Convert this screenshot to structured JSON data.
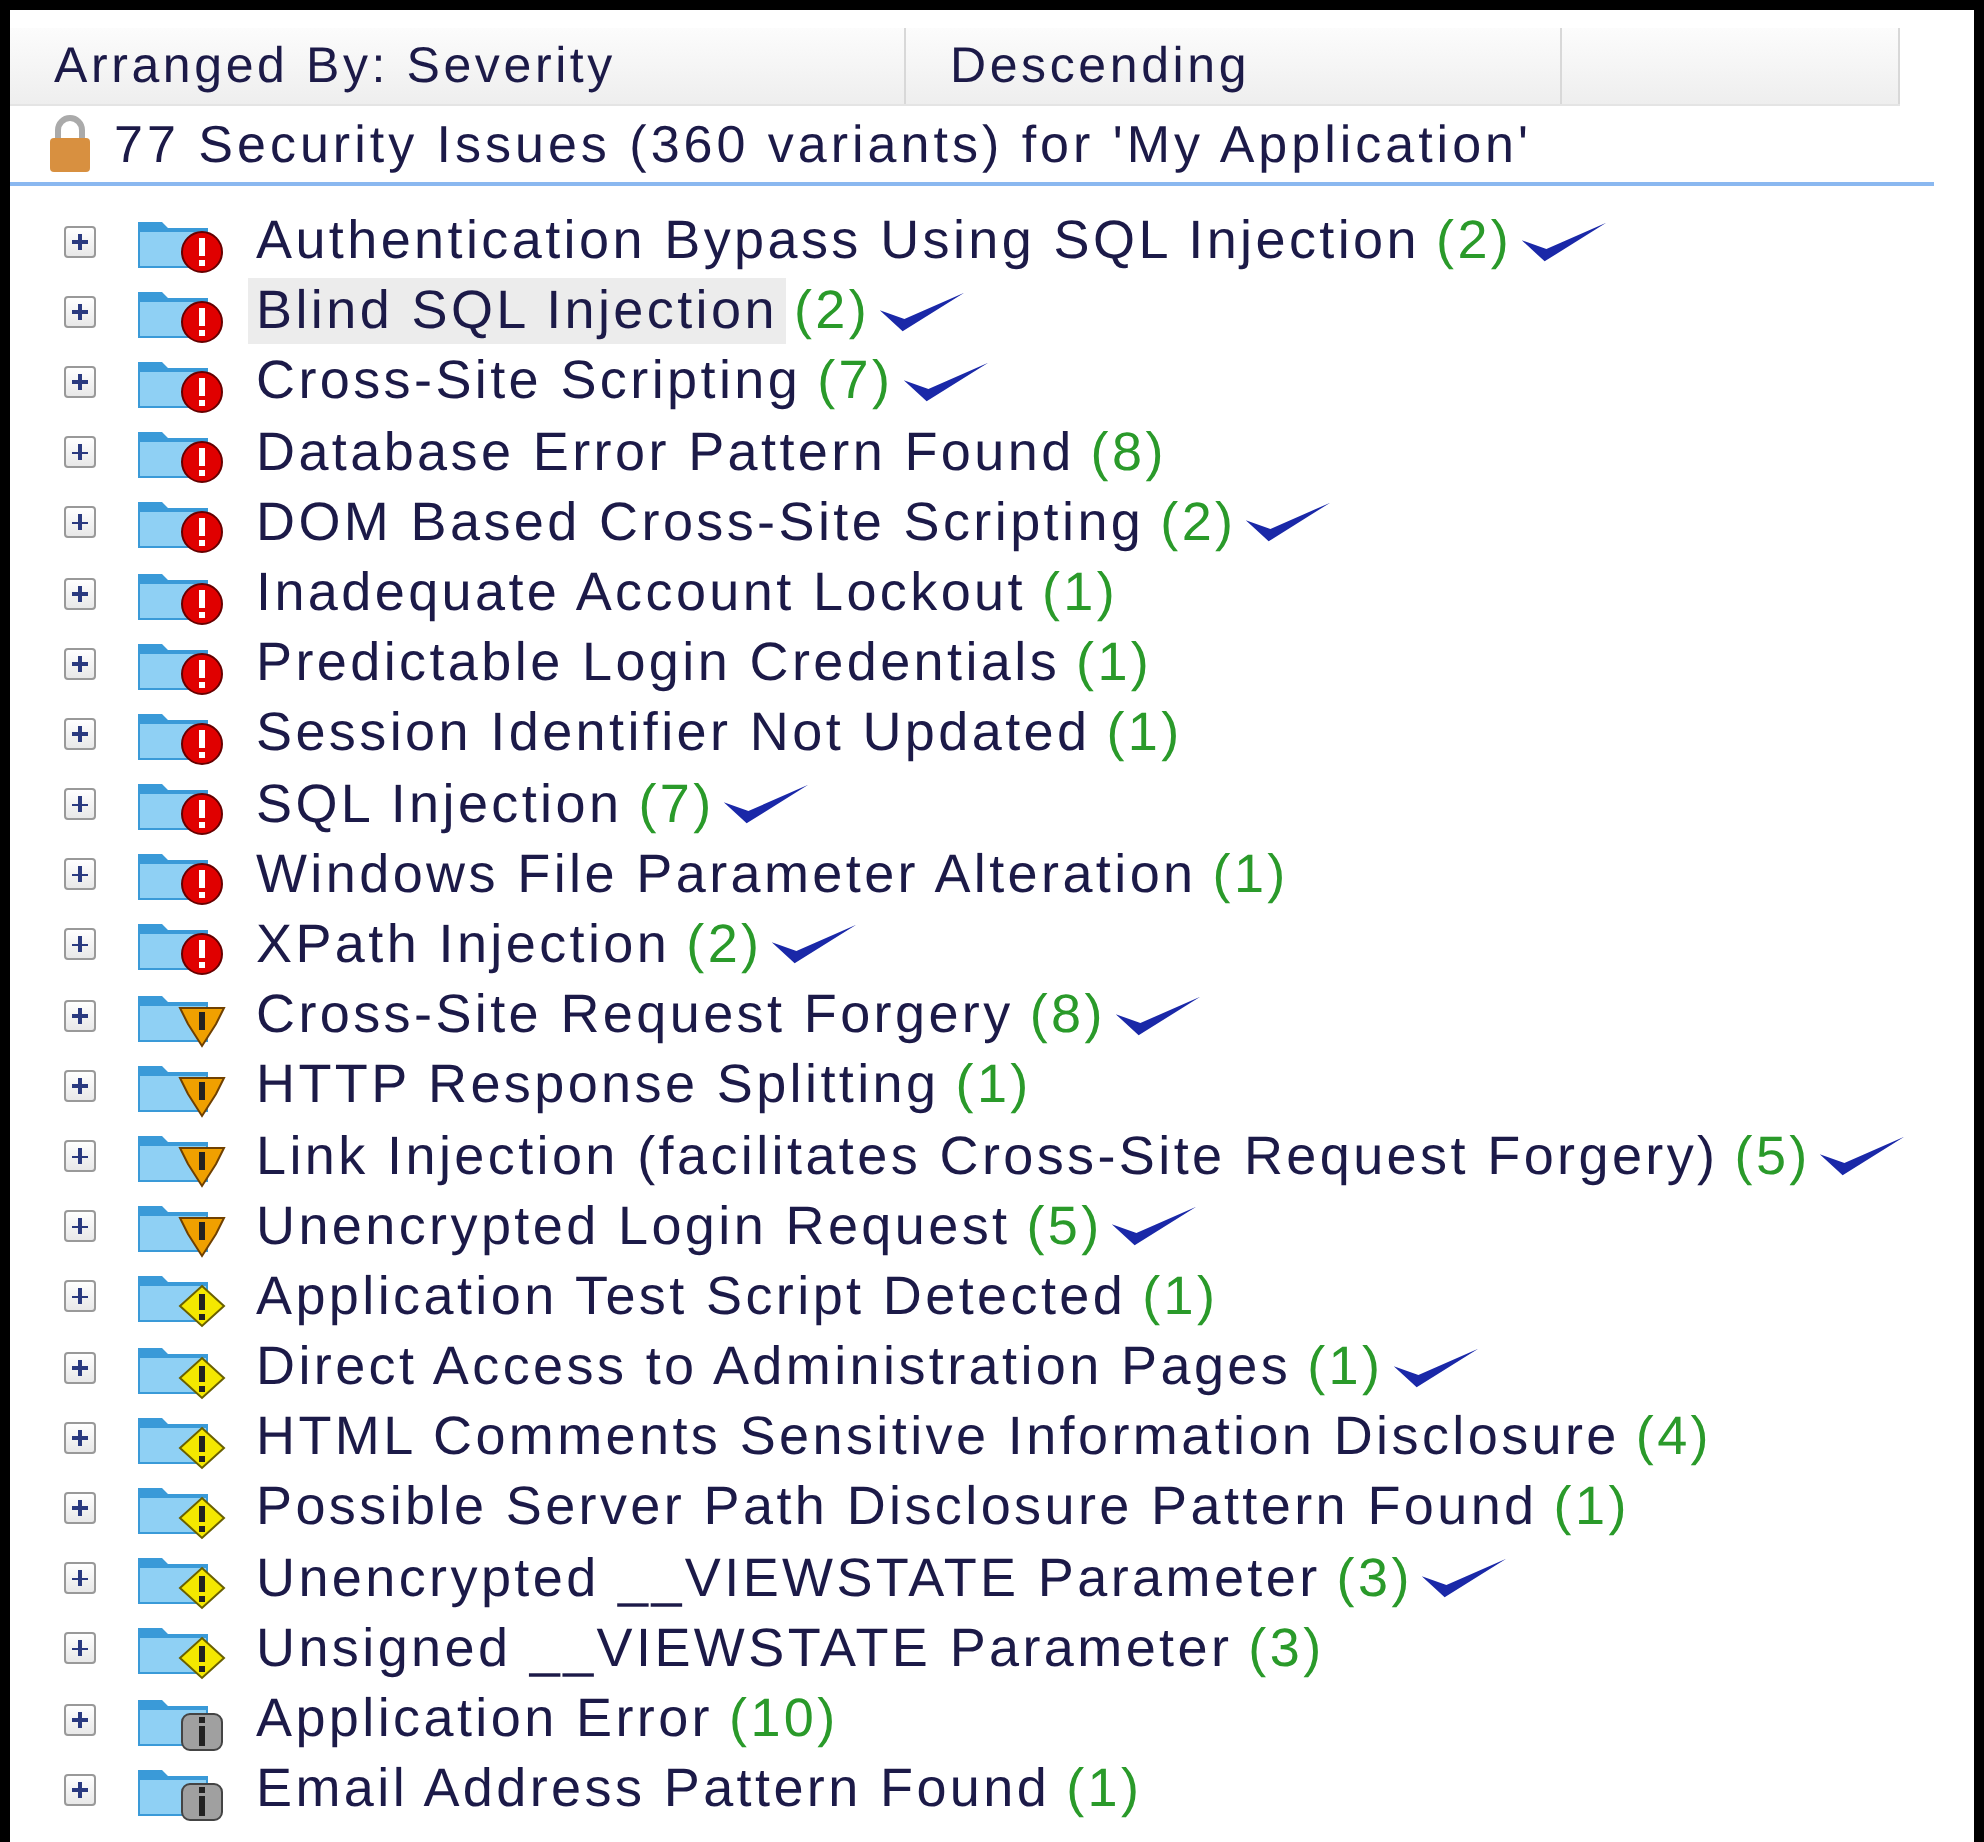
{
  "header": {
    "arranged_by": "Arranged By: Severity",
    "order": "Descending"
  },
  "summary": "77 Security Issues (360 variants) for 'My Application'",
  "issues": [
    {
      "name": "Authentication Bypass Using SQL Injection",
      "count": "(2)",
      "kind": "high",
      "checked": true,
      "selected": false
    },
    {
      "name": "Blind SQL Injection",
      "count": "(2)",
      "kind": "high",
      "checked": true,
      "selected": true
    },
    {
      "name": "Cross-Site Scripting",
      "count": "(7)",
      "kind": "high",
      "checked": true,
      "selected": false
    },
    {
      "name": "Database Error Pattern Found",
      "count": "(8)",
      "kind": "high",
      "checked": false,
      "selected": false
    },
    {
      "name": "DOM Based Cross-Site Scripting",
      "count": "(2)",
      "kind": "high",
      "checked": true,
      "selected": false
    },
    {
      "name": "Inadequate Account Lockout",
      "count": "(1)",
      "kind": "high",
      "checked": false,
      "selected": false
    },
    {
      "name": "Predictable Login Credentials",
      "count": "(1)",
      "kind": "high",
      "checked": false,
      "selected": false
    },
    {
      "name": "Session Identifier Not Updated",
      "count": "(1)",
      "kind": "high",
      "checked": false,
      "selected": false
    },
    {
      "name": "SQL Injection",
      "count": "(7)",
      "kind": "high",
      "checked": true,
      "selected": false
    },
    {
      "name": "Windows File Parameter Alteration",
      "count": "(1)",
      "kind": "high",
      "checked": false,
      "selected": false
    },
    {
      "name": "XPath Injection",
      "count": "(2)",
      "kind": "high",
      "checked": true,
      "selected": false
    },
    {
      "name": "Cross-Site Request Forgery",
      "count": "(8)",
      "kind": "medium",
      "checked": true,
      "selected": false
    },
    {
      "name": "HTTP Response Splitting",
      "count": "(1)",
      "kind": "medium",
      "checked": false,
      "selected": false
    },
    {
      "name": "Link Injection (facilitates Cross-Site Request Forgery)",
      "count": "(5)",
      "kind": "medium",
      "checked": true,
      "selected": false
    },
    {
      "name": "Unencrypted Login Request",
      "count": "(5)",
      "kind": "medium",
      "checked": true,
      "selected": false
    },
    {
      "name": "Application Test Script Detected",
      "count": "(1)",
      "kind": "low",
      "checked": false,
      "selected": false
    },
    {
      "name": "Direct Access to Administration Pages",
      "count": "(1)",
      "kind": "low",
      "checked": true,
      "selected": false
    },
    {
      "name": "HTML Comments Sensitive Information Disclosure",
      "count": "(4)",
      "kind": "low",
      "checked": false,
      "selected": false
    },
    {
      "name": "Possible Server Path Disclosure Pattern Found",
      "count": "(1)",
      "kind": "low",
      "checked": false,
      "selected": false
    },
    {
      "name": "Unencrypted __VIEWSTATE Parameter",
      "count": "(3)",
      "kind": "low",
      "checked": true,
      "selected": false
    },
    {
      "name": "Unsigned __VIEWSTATE Parameter",
      "count": "(3)",
      "kind": "low",
      "checked": false,
      "selected": false
    },
    {
      "name": "Application Error",
      "count": "(10)",
      "kind": "info",
      "checked": false,
      "selected": false
    },
    {
      "name": "Email Address Pattern Found",
      "count": "(1)",
      "kind": "info",
      "checked": false,
      "selected": false
    }
  ]
}
